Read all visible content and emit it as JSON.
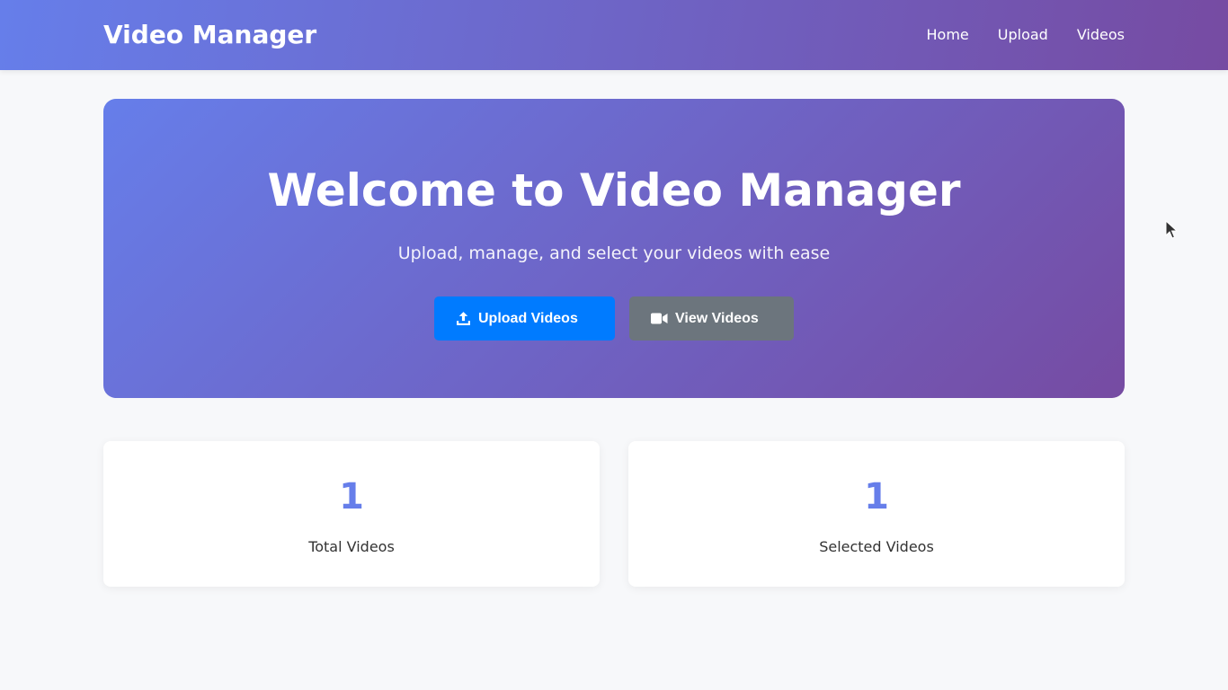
{
  "header": {
    "brand": "Video Manager",
    "nav": [
      {
        "label": "Home"
      },
      {
        "label": "Upload"
      },
      {
        "label": "Videos"
      }
    ]
  },
  "hero": {
    "title": "Welcome to Video Manager",
    "subtitle": "Upload, manage, and select your videos with ease",
    "buttons": {
      "upload": {
        "label": "Upload Videos",
        "icon": "upload-icon"
      },
      "view": {
        "label": "View Videos",
        "icon": "video-camera-icon"
      }
    }
  },
  "stats": [
    {
      "value": "1",
      "label": "Total Videos"
    },
    {
      "value": "1",
      "label": "Selected Videos"
    }
  ],
  "colors": {
    "gradient_start": "#667eea",
    "gradient_end": "#764ba2",
    "primary": "#007bff",
    "secondary": "#6c757d",
    "stat_accent": "#667eea",
    "background": "#f7f8fa"
  }
}
